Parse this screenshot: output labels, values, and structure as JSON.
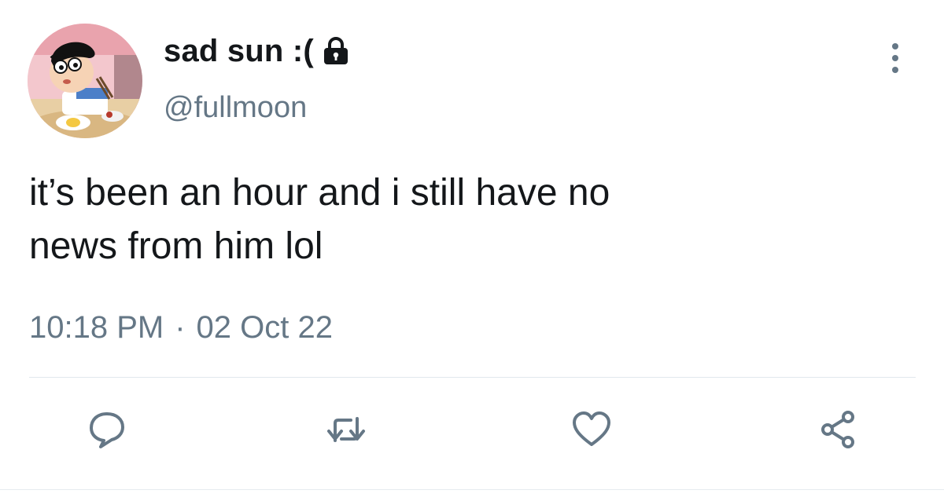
{
  "tweet": {
    "display_name": "sad sun :(",
    "handle": "@fullmoon",
    "text": "it’s been an hour and i still have no\nnews from him lol",
    "time": "10:18 PM",
    "separator": "·",
    "date": "02 Oct 22",
    "protected": true
  },
  "icons": {
    "lock": "lock-icon",
    "more": "more-vertical-icon",
    "reply": "reply-icon",
    "retweet": "retweet-icon",
    "like": "heart-icon",
    "share": "share-icon"
  },
  "colors": {
    "text_primary": "#14171a",
    "text_secondary": "#657786",
    "icon": "#657786",
    "divider": "#e1e8ed"
  }
}
